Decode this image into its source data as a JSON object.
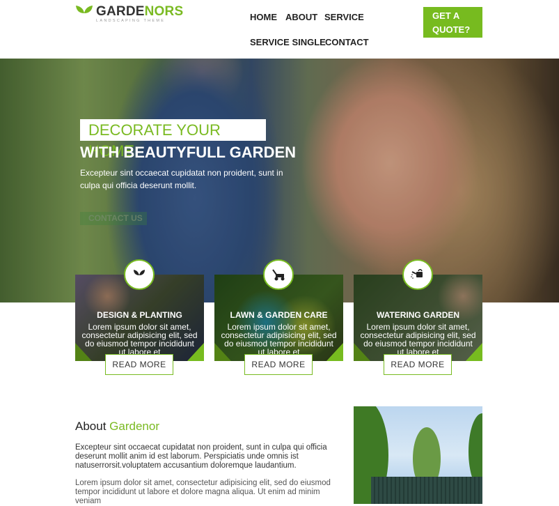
{
  "header": {
    "logo": {
      "name_dark": "GARDE",
      "name_green": "NORS",
      "tagline": "LANDSCAPING THEME"
    },
    "nav": [
      "HOME",
      "ABOUT",
      "SERVICE",
      "SERVICE SINGLE",
      "CONTACT"
    ],
    "quote_button": "GET A QUOTE?"
  },
  "hero": {
    "kicker": "DECORATE YOUR HOME",
    "title": "WITH BEAUTYFULL GARDEN",
    "text": "Excepteur sint occaecat cupidatat non proident, sunt in culpa qui officia deserunt mollit.",
    "button": "CONTACT US"
  },
  "services": [
    {
      "icon": "leaf-icon",
      "title": "DESIGN & PLANTING",
      "text": "Lorem ipsum dolor sit amet, consectetur adipisicing elit, sed do eiusmod tempor incididunt ut labore et",
      "button": "READ MORE"
    },
    {
      "icon": "lawn-mower-icon",
      "title": "LAWN & GARDEN CARE",
      "text": "Lorem ipsum dolor sit amet, consectetur adipisicing elit, sed do eiusmod tempor incididunt ut labore et",
      "button": "READ MORE"
    },
    {
      "icon": "watering-can-icon",
      "title": "WATERING GARDEN",
      "text": "Lorem ipsum dolor sit amet, consectetur adipisicing elit, sed do eiusmod tempor incididunt ut labore et",
      "button": "READ MORE"
    }
  ],
  "about": {
    "title_dark": "About ",
    "title_green": "Gardenor",
    "paragraphs": [
      "Excepteur sint occaecat cupidatat non proident, sunt in culpa qui officia deserunt mollit anim id est laborum. Perspiciatis unde omnis ist natuserrorsit.voluptatem accusantium doloremque laudantium.",
      "Lorem ipsum dolor sit amet, consectetur adipisicing elit, sed do eiusmod tempor incididunt ut labore et dolore magna aliqua. Ut enim ad minim veniam"
    ]
  },
  "colors": {
    "accent": "#77bb1f",
    "text": "#222222"
  }
}
